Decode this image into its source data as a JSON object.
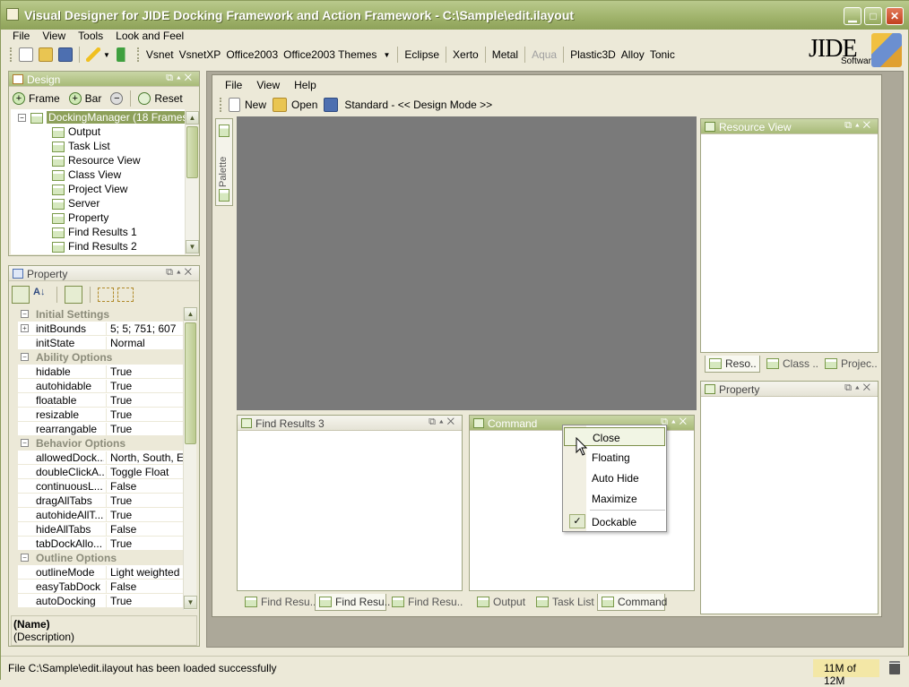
{
  "window": {
    "title": "Visual Designer for JIDE Docking Framework and Action Framework - C:\\Sample\\edit.ilayout"
  },
  "menu": [
    "File",
    "View",
    "Tools",
    "Look and Feel"
  ],
  "toolbar": {
    "laf": [
      "Vsnet",
      "VsnetXP",
      "Office2003",
      "Office2003 Themes",
      "Eclipse",
      "Xerto",
      "Metal",
      "Aqua",
      "Plastic3D",
      "Alloy",
      "Tonic"
    ]
  },
  "logo": {
    "text": "JIDE",
    "sub": "Software",
    "cube": "JIDE"
  },
  "design": {
    "title": "Design",
    "frame_label": "Frame",
    "bar_label": "Bar",
    "reset_label": "Reset",
    "root": "DockingManager (18 Frames)",
    "items": [
      "Output",
      "Task List",
      "Resource View",
      "Class View",
      "Project View",
      "Server",
      "Property",
      "Find Results 1",
      "Find Results 2"
    ]
  },
  "property": {
    "title": "Property",
    "categories": [
      {
        "name": "Initial Settings",
        "rows": [
          {
            "name": "initBounds",
            "value": "5; 5; 751; 607",
            "expand": "+"
          },
          {
            "name": "initState",
            "value": "Normal"
          }
        ]
      },
      {
        "name": "Ability Options",
        "rows": [
          {
            "name": "hidable",
            "value": "True"
          },
          {
            "name": "autohidable",
            "value": "True"
          },
          {
            "name": "floatable",
            "value": "True"
          },
          {
            "name": "resizable",
            "value": "True"
          },
          {
            "name": "rearrangable",
            "value": "True"
          }
        ]
      },
      {
        "name": "Behavior Options",
        "rows": [
          {
            "name": "allowedDock...",
            "value": "North, South, E..."
          },
          {
            "name": "doubleClickA...",
            "value": "Toggle Float"
          },
          {
            "name": "continuousL...",
            "value": "False"
          },
          {
            "name": "dragAllTabs",
            "value": "True"
          },
          {
            "name": "autohideAllT...",
            "value": "True"
          },
          {
            "name": "hideAllTabs",
            "value": "False"
          },
          {
            "name": "tabDockAllo...",
            "value": "True"
          }
        ]
      },
      {
        "name": "Outline Options",
        "rows": [
          {
            "name": "outlineMode",
            "value": "Light weighted"
          },
          {
            "name": "easyTabDock",
            "value": "False"
          },
          {
            "name": "autoDocking",
            "value": "True"
          }
        ]
      }
    ],
    "desc_name": "(Name)",
    "desc_text": "(Description)"
  },
  "preview": {
    "menu": [
      "File",
      "View",
      "Help"
    ],
    "new_label": "New",
    "open_label": "Open",
    "mode_label": "Standard - << Design Mode >>",
    "palette": "Palette",
    "resource_view": "Resource View",
    "property": "Property",
    "right_tabs": [
      "Reso..",
      "Class ..",
      "Projec.."
    ],
    "find_results": "Find Results 3",
    "find_tabs": [
      "Find Resu..",
      "Find Resu..",
      "Find Resu.."
    ],
    "command": "Command",
    "cmd_tabs": [
      "Output",
      "Task List",
      "Command"
    ]
  },
  "context_menu": {
    "items": [
      {
        "label": "Close",
        "highlighted": true
      },
      {
        "label": "Floating"
      },
      {
        "label": "Auto Hide"
      },
      {
        "label": "Maximize"
      },
      {
        "label": "Dockable",
        "checked": true
      }
    ]
  },
  "status": {
    "message": "File C:\\Sample\\edit.ilayout has been loaded successfully",
    "memory": "11M of 12M"
  },
  "colors": {
    "accent": "#a8ba78",
    "canvas": "#7a7a7a"
  }
}
